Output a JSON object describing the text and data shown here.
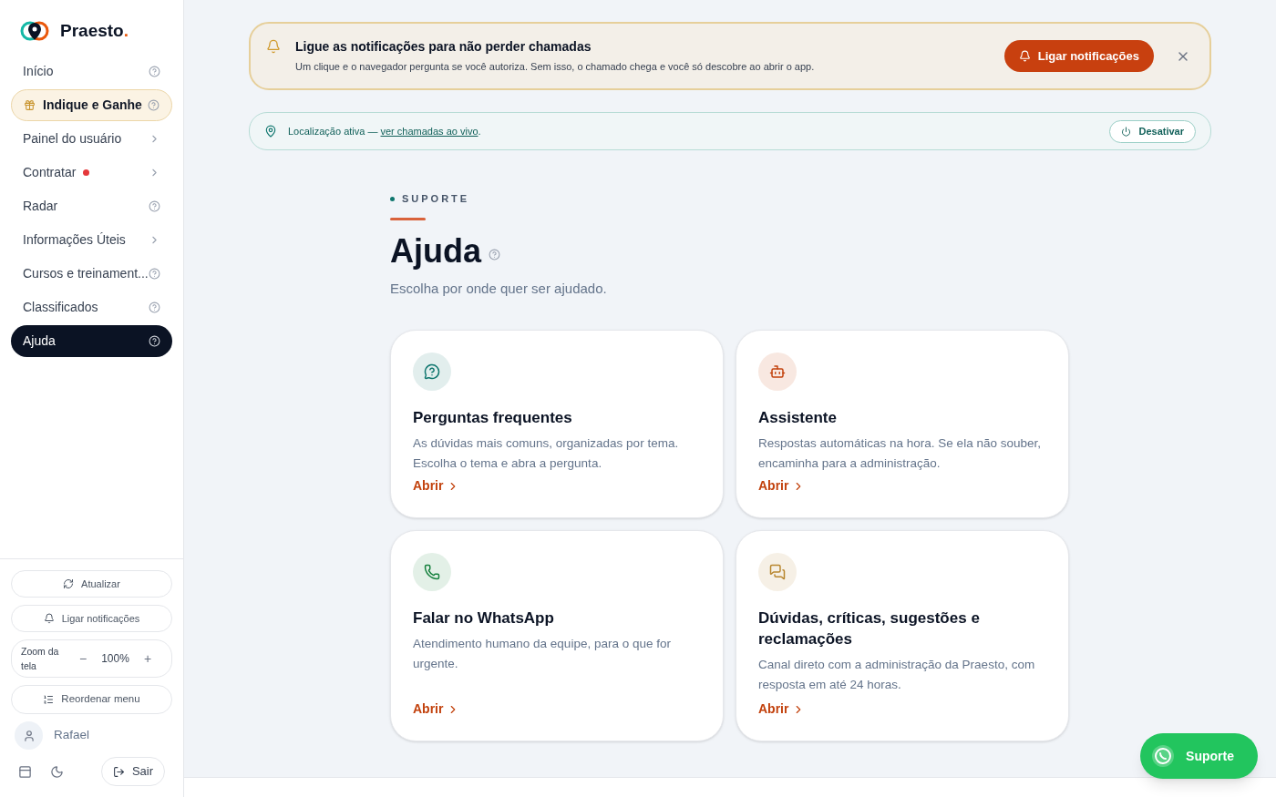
{
  "brand": {
    "name": "Praesto",
    "mark": "."
  },
  "sidebar": {
    "items": [
      {
        "label": "Início",
        "kind": "help",
        "selected": false,
        "highlighted": false,
        "dot": false
      },
      {
        "label": "Indique e Ganhe",
        "kind": "help",
        "selected": false,
        "highlighted": true,
        "dot": false
      },
      {
        "label": "Painel do usuário",
        "kind": "chevron",
        "selected": false,
        "highlighted": false,
        "dot": false
      },
      {
        "label": "Contratar",
        "kind": "chevron",
        "selected": false,
        "highlighted": false,
        "dot": true
      },
      {
        "label": "Radar",
        "kind": "help",
        "selected": false,
        "highlighted": false,
        "dot": false
      },
      {
        "label": "Informações Úteis",
        "kind": "chevron",
        "selected": false,
        "highlighted": false,
        "dot": false
      },
      {
        "label": "Cursos e treinament...",
        "kind": "help",
        "selected": false,
        "highlighted": false,
        "dot": false
      },
      {
        "label": "Classificados",
        "kind": "help",
        "selected": false,
        "highlighted": false,
        "dot": false
      },
      {
        "label": "Ajuda",
        "kind": "help",
        "selected": true,
        "highlighted": false,
        "dot": false
      }
    ],
    "refresh": "Atualizar",
    "notify": "Ligar notificações",
    "zoom": {
      "label": "Zoom da tela",
      "minus": "−",
      "value": "100%",
      "plus": "+"
    },
    "reorder": "Reordenar menu",
    "user": "Rafael",
    "logout": "Sair"
  },
  "notice": {
    "title": "Ligue as notificações para não perder chamadas",
    "text": "Um clique e o navegador pergunta se você autoriza. Sem isso, o chamado chega e você só descobre ao abrir o app.",
    "button": "Ligar notificações"
  },
  "location": {
    "text": "Localização ativa — ",
    "link": "ver chamadas ao vivo",
    "end": ".",
    "button": "Desativar"
  },
  "header": {
    "eyebrow": "SUPORTE",
    "title": "Ajuda",
    "subtitle": "Escolha por onde quer ser ajudado."
  },
  "cards": [
    {
      "kind": "faq",
      "color": "#0f766e",
      "title": "Perguntas frequentes",
      "text": "As dúvidas mais comuns, organizadas por tema. Escolha o tema e abra a pergunta.",
      "link": "Abrir"
    },
    {
      "kind": "bot",
      "color": "#c2410c",
      "title": "Assistente",
      "text": "Respostas automáticas na hora. Se ela não souber, encaminha para a administração.",
      "link": "Abrir"
    },
    {
      "kind": "phone",
      "color": "#15803d",
      "title": "Falar no WhatsApp",
      "text": "Atendimento humano da equipe, para o que for urgente.",
      "link": "Abrir"
    },
    {
      "kind": "chat",
      "color": "#b8862f",
      "title": "Dúvidas, críticas, sugestões e reclamações",
      "text": "Canal direto com a administração da Praesto, com resposta em até 24 horas.",
      "link": "Abrir"
    }
  ],
  "support_button": "Suporte"
}
